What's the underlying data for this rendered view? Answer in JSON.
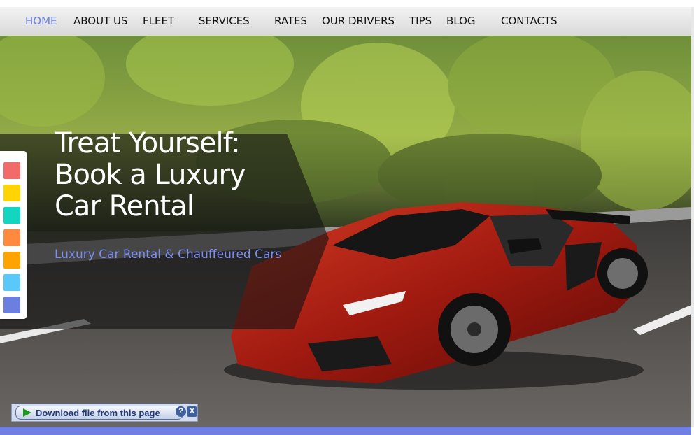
{
  "nav": {
    "items": [
      {
        "label": "HOME",
        "active": true
      },
      {
        "label": "ABOUT US",
        "active": false
      },
      {
        "label": "FLEET",
        "active": false
      },
      {
        "label": "SERVICES",
        "active": false
      },
      {
        "label": "RATES",
        "active": false
      },
      {
        "label": "OUR DRIVERS",
        "active": false
      },
      {
        "label": "TIPS",
        "active": false
      },
      {
        "label": "BLOG",
        "active": false
      },
      {
        "label": "CONTACTS",
        "active": false
      }
    ],
    "active_color": "#6a7fe0"
  },
  "hero": {
    "title": "Treat Yourself: Book a Luxury Car Rental",
    "subtitle": "Luxury Car Rental & Chauffeured Cars",
    "image": "red-sports-car-on-forest-road"
  },
  "color_switcher": {
    "swatches": [
      "#f26a6a",
      "#ffd400",
      "#12d6c0",
      "#ff8a3d",
      "#ffa300",
      "#5ac8fa",
      "#6a7fe0"
    ]
  },
  "download_bar": {
    "button_label": "Download file from this page",
    "help_label": "?",
    "close_label": "X",
    "icon": "play-icon"
  },
  "accent_color": "#6f7fe3"
}
